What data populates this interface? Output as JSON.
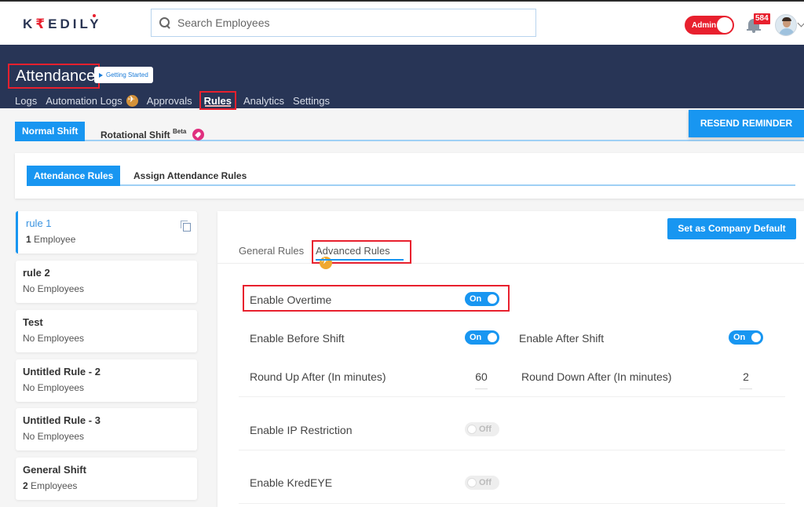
{
  "app": {
    "logo": {
      "k": "K",
      "rupee": "₹",
      "rest": "EDIL",
      "y": "Y"
    },
    "search_placeholder": "Search Employees",
    "admin_label": "Admin",
    "notification_count": "584"
  },
  "header": {
    "title": "Attendance",
    "getting_started": "Getting Started",
    "nav": [
      {
        "label": "Logs"
      },
      {
        "label": "Automation Logs"
      },
      {
        "label": "Approvals"
      },
      {
        "label": "Rules"
      },
      {
        "label": "Analytics"
      },
      {
        "label": "Settings"
      }
    ]
  },
  "shift_tabs": {
    "normal": "Normal Shift",
    "rotational": "Rotational Shift",
    "rotational_sup": "Beta",
    "resend": "RESEND REMINDER"
  },
  "rule_tabs": {
    "attendance_rules": "Attendance Rules",
    "assign_rules": "Assign Attendance Rules"
  },
  "rules": [
    {
      "name": "rule 1",
      "count_num": "1",
      "count_text": "Employee"
    },
    {
      "name": "rule 2",
      "count_num": "",
      "count_text": "No Employees"
    },
    {
      "name": "Test",
      "count_num": "",
      "count_text": "No Employees"
    },
    {
      "name": "Untitled Rule - 2",
      "count_num": "",
      "count_text": "No Employees"
    },
    {
      "name": "Untitled Rule - 3",
      "count_num": "",
      "count_text": "No Employees"
    },
    {
      "name": "General Shift",
      "count_num": "2",
      "count_text": "Employees"
    }
  ],
  "main": {
    "company_default": "Set as Company Default",
    "tabs": {
      "general": "General Rules",
      "advanced": "Advanced Rules"
    },
    "settings": {
      "overtime": {
        "label": "Enable Overtime",
        "state": "On"
      },
      "before_shift": {
        "label": "Enable Before Shift",
        "state": "On"
      },
      "after_shift": {
        "label": "Enable After Shift",
        "state": "On"
      },
      "round_up": {
        "label": "Round Up After (In minutes)",
        "value": "60"
      },
      "round_down": {
        "label": "Round Down After (In minutes)",
        "value": "2"
      },
      "ip_restriction": {
        "label": "Enable IP Restriction",
        "state": "Off"
      },
      "kredeye": {
        "label": "Enable KredEYE",
        "state": "Off"
      }
    }
  },
  "colors": {
    "primary": "#1896f1",
    "header_band": "#283556",
    "highlight_red": "#e8202e"
  }
}
